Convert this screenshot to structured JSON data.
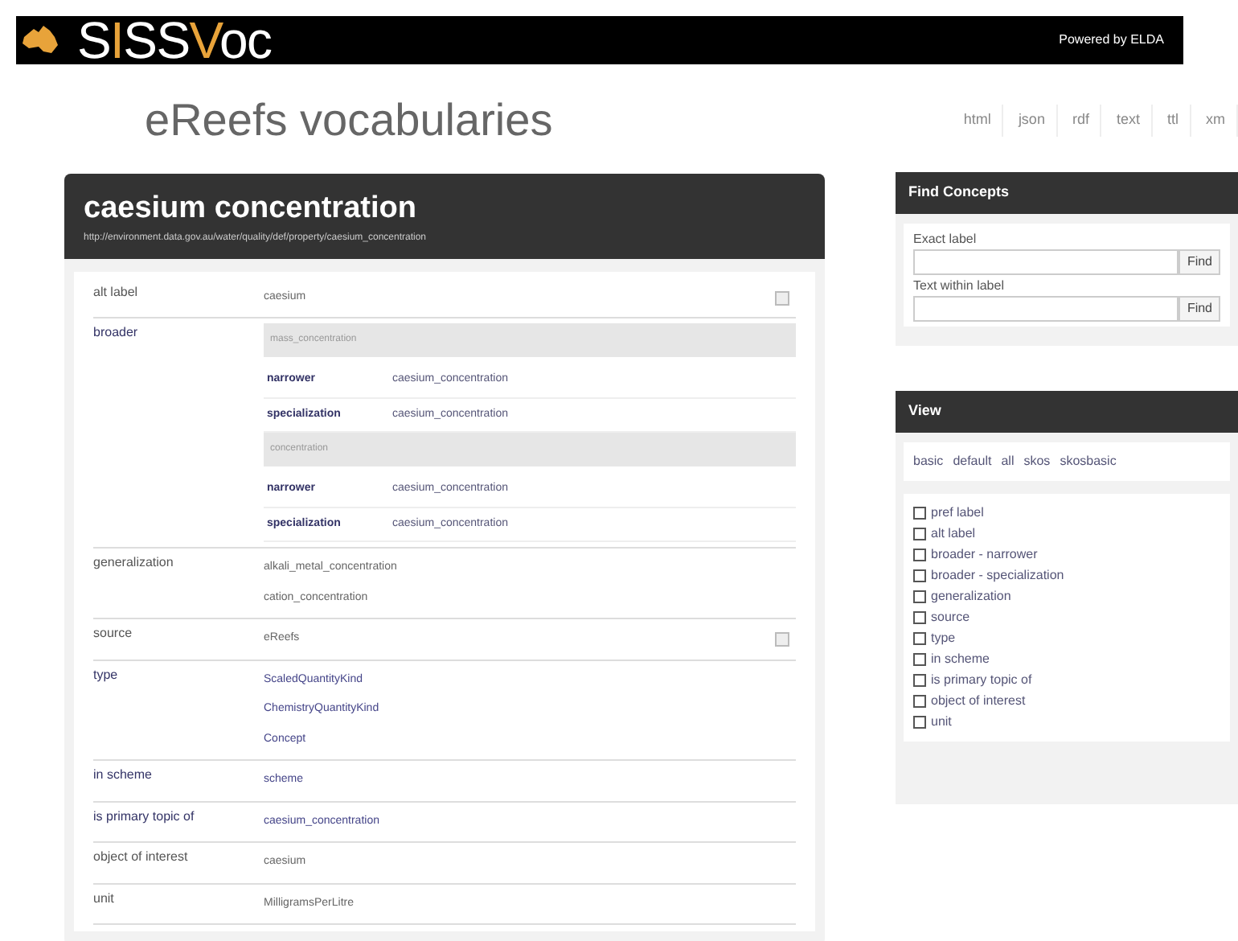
{
  "banner": {
    "logo": "SISSVoc",
    "powered_by": "Powered by ELDA"
  },
  "title": "eReefs vocabularies",
  "formats": [
    "html",
    "json",
    "rdf",
    "text",
    "ttl",
    "xm"
  ],
  "concept": {
    "label": "caesium concentration",
    "uri": "http://environment.data.gov.au/water/quality/def/property/caesium_concentration",
    "properties": [
      {
        "kind": "plain",
        "name": "alt label",
        "values": [
          "caesium"
        ],
        "language_tag": true
      },
      {
        "kind": "nested",
        "name": "broader",
        "groups": [
          {
            "title": "mass_concentration",
            "rows": [
              {
                "name": "narrower",
                "value": "caesium_concentration"
              },
              {
                "name": "specialization",
                "value": "caesium_concentration"
              }
            ]
          },
          {
            "title": "concentration",
            "rows": [
              {
                "name": "narrower",
                "value": "caesium_concentration"
              },
              {
                "name": "specialization",
                "value": "caesium_concentration"
              }
            ]
          }
        ]
      },
      {
        "kind": "plain",
        "name": "generalization",
        "values": [
          "alkali_metal_concentration",
          "cation_concentration"
        ]
      },
      {
        "kind": "plain",
        "name": "source",
        "values": [
          "eReefs"
        ],
        "language_tag": true
      },
      {
        "kind": "link",
        "name": "type",
        "values": [
          "ScaledQuantityKind",
          "ChemistryQuantityKind",
          "Concept"
        ]
      },
      {
        "kind": "link",
        "name": "in scheme",
        "values": [
          "scheme"
        ]
      },
      {
        "kind": "link",
        "name": "is primary topic of",
        "values": [
          "caesium_concentration"
        ]
      },
      {
        "kind": "plain",
        "name": "object of interest",
        "values": [
          "caesium"
        ]
      },
      {
        "kind": "plain",
        "name": "unit",
        "values": [
          "MilligramsPerLitre"
        ]
      }
    ]
  },
  "find_concepts": {
    "title": "Find Concepts",
    "fields": [
      {
        "label": "Exact label",
        "button": "Find"
      },
      {
        "label": "Text within label",
        "button": "Find"
      }
    ]
  },
  "view": {
    "title": "View",
    "views": [
      "basic",
      "default",
      "all",
      "skos",
      "skosbasic"
    ],
    "properties": [
      {
        "label": "pref label",
        "checked": false
      },
      {
        "label": "alt label",
        "checked": false
      },
      {
        "label": "broader - narrower",
        "checked": false
      },
      {
        "label": "broader - specialization",
        "checked": false
      },
      {
        "label": "generalization",
        "checked": false
      },
      {
        "label": "source",
        "checked": false
      },
      {
        "label": "type",
        "checked": false
      },
      {
        "label": "in scheme",
        "checked": false
      },
      {
        "label": "is primary topic of",
        "checked": false
      },
      {
        "label": "object of interest",
        "checked": false
      },
      {
        "label": "unit",
        "checked": false
      }
    ]
  }
}
